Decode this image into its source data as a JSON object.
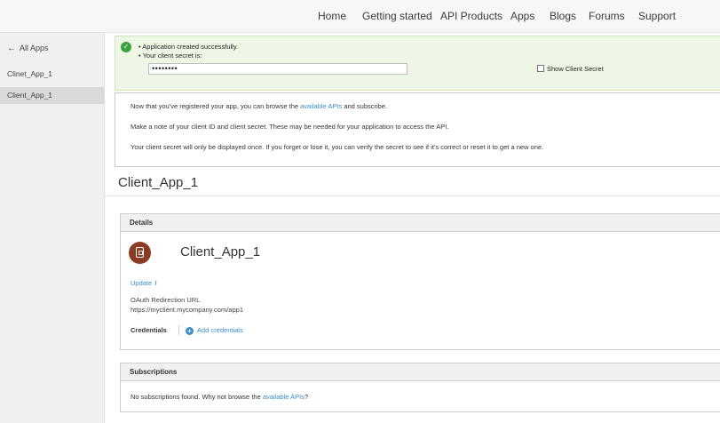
{
  "nav": {
    "items": [
      "Home",
      "Getting started",
      "API Products",
      "Apps",
      "Blogs",
      "Forums",
      "Support"
    ]
  },
  "sidebar": {
    "back_label": "All Apps",
    "items": [
      {
        "label": "Clinet_App_1",
        "active": false
      },
      {
        "label": "Client_App_1",
        "active": true
      }
    ]
  },
  "alert": {
    "line1": "Application created successfully.",
    "line2": "Your client secret is:",
    "secret_value": "••••••••",
    "show_secret_label": "Show Client Secret"
  },
  "info": {
    "p1_before": "Now that you've registered your app, you can browse the ",
    "p1_link": "available APIs",
    "p1_after": " and subscribe.",
    "p2": "Make a note of your client ID and client secret. These may be needed for your application to access the API.",
    "p3": "Your client secret will only be displayed once. If you forget or lose it, you can verify the secret to see if it's correct or reset it to get a new one."
  },
  "page_title": "Client_App_1",
  "details": {
    "header": "Details",
    "app_name": "Client_App_1",
    "update_label": "Update",
    "oauth_label": "OAuth Redirection URL",
    "oauth_url": "https://myclient.mycompany.com/app1",
    "credentials_label": "Credentials",
    "add_credentials_label": "Add credentials"
  },
  "subscriptions": {
    "header": "Subscriptions",
    "text_before": "No subscriptions found. Why not browse the ",
    "link": "available APIs",
    "text_after": "?"
  },
  "colors": {
    "accent": "#3b8ec9",
    "success_bg": "#eef7e6",
    "success_icon": "#3aa23a",
    "avatar": "#8a3c22"
  }
}
